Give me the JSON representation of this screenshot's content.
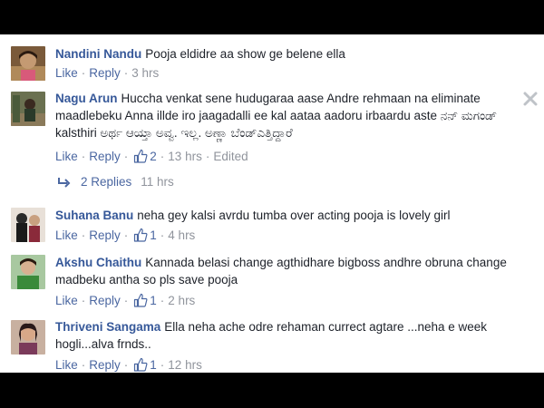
{
  "labels": {
    "like": "Like",
    "reply": "Reply",
    "sep": "·"
  },
  "comments": [
    {
      "author": "Nandini Nandu",
      "text": "Pooja eldidre aa show ge belene ella",
      "likes": "",
      "time": "3 hrs",
      "avatar_colors": [
        "#6b4a2b",
        "#c79a6a"
      ]
    },
    {
      "author": "Nagu Arun",
      "text": "Huccha venkat sene hudugaraa aase Andre rehmaan na eliminate maadlebeku Anna illde iro jaagadalli ee kal aataa aadoru irbaardu aste ನನ್ ಮಗಂಡ್ kalsthiri ಅರ್ಥ ಆಯ್ತಾ ಅವ್ವ. ಇಲ್ಲ. ಅಣ್ಣಾ ಬೆಂಡ್ಎತ್ತಿದ್ದಾರೆ",
      "likes": "2",
      "time": "13 hrs",
      "edited": "Edited",
      "avatar_colors": [
        "#4a5a3a",
        "#8f8a6a"
      ],
      "replies_label": "2 Replies",
      "replies_time": "11 hrs"
    },
    {
      "author": "Suhana Banu",
      "text": "neha gey kalsi avrdu tumba over acting pooja is lovely girl",
      "likes": "1",
      "time": "4 hrs",
      "avatar_colors": [
        "#2a2a2a",
        "#d8c8b8"
      ]
    },
    {
      "author": "Akshu Chaithu",
      "text": "Kannada belasi change agthidhare bigboss andhre obruna change madbeku antha so pls save pooja",
      "likes": "1",
      "time": "2 hrs",
      "avatar_colors": [
        "#3a7a3a",
        "#e6c7a8"
      ]
    },
    {
      "author": "Thriveni Sangama",
      "text": "Ella neha ache odre rehaman currect agtare ...neha e week hogli...alva frnds..",
      "likes": "1",
      "time": "12 hrs",
      "avatar_colors": [
        "#9a7a6a",
        "#3a2a2a"
      ]
    }
  ]
}
